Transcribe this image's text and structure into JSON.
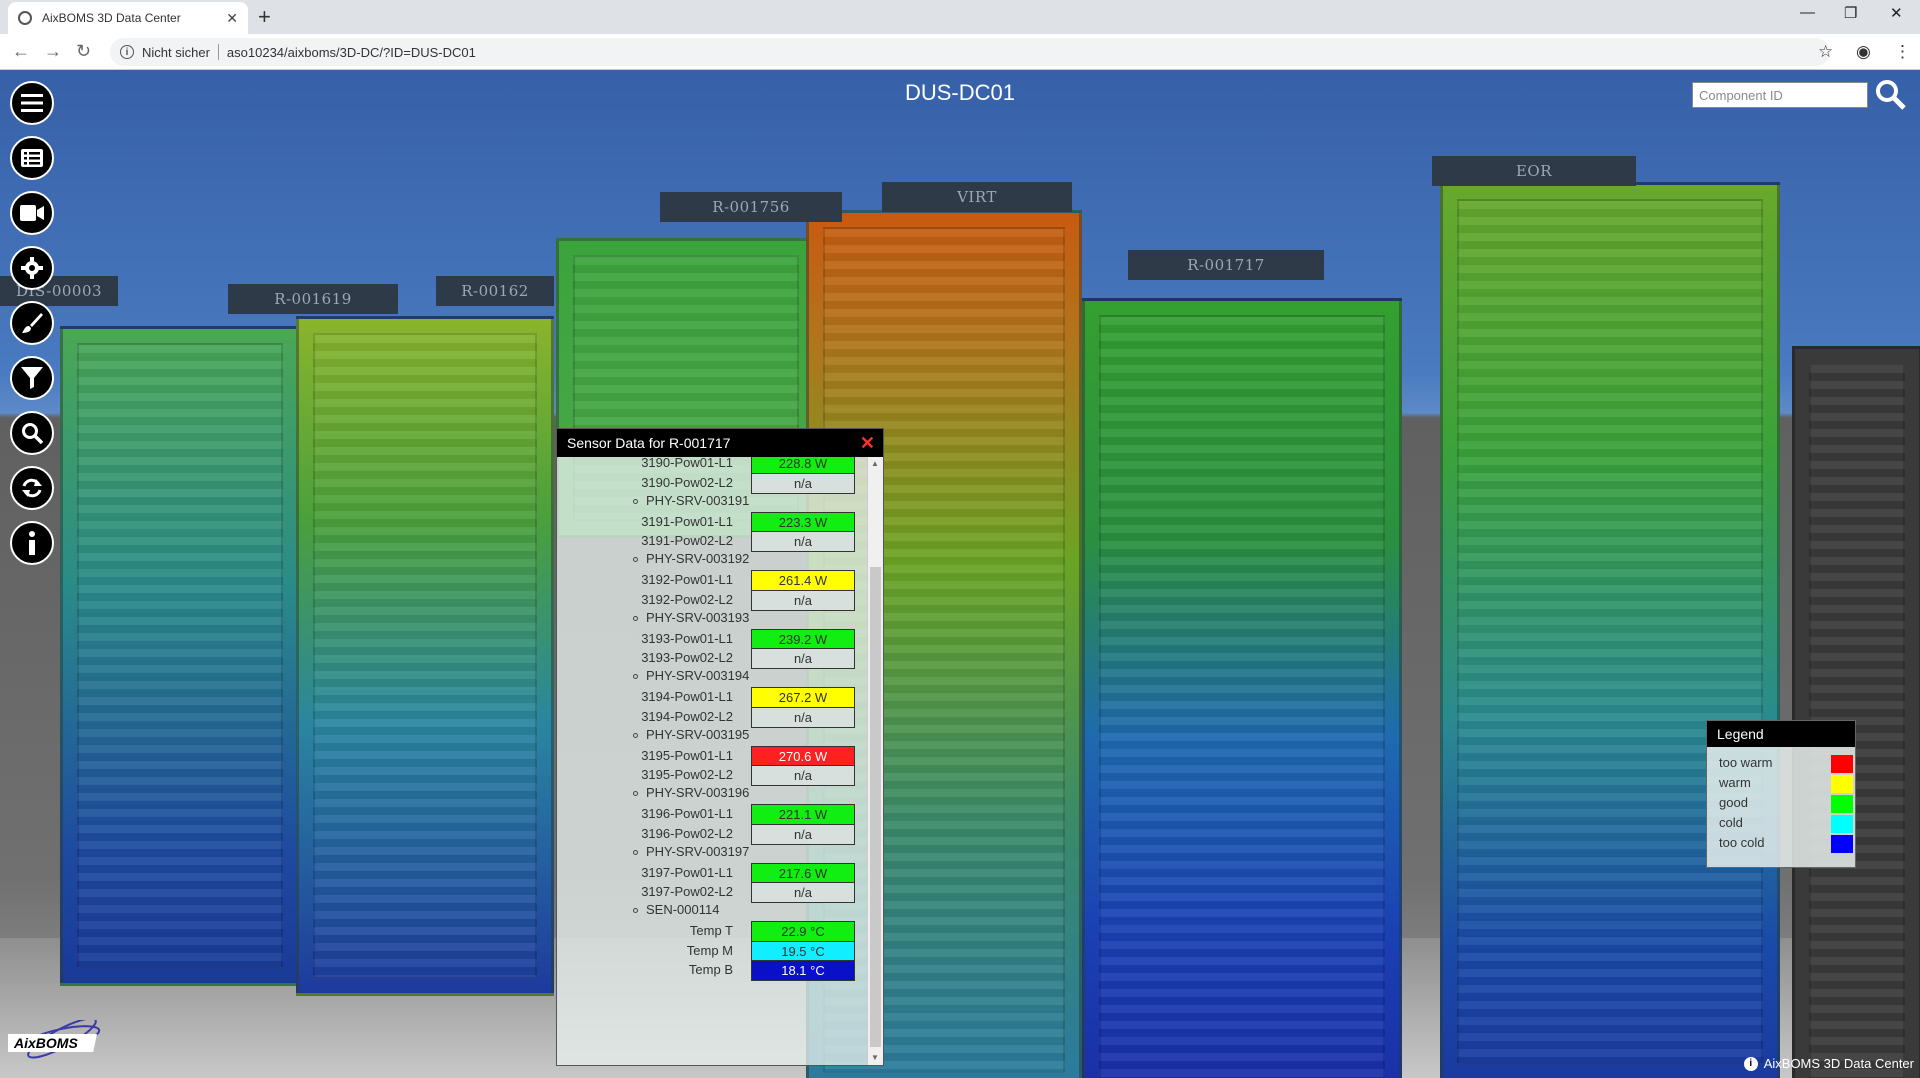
{
  "browser": {
    "tab_title": "AixBOMS 3D Data Center",
    "security_label": "Nicht sicher",
    "url": "aso10234/aixboms/3D-DC/?ID=DUS-DC01"
  },
  "app": {
    "title": "DUS-DC01",
    "search_placeholder": "Component ID",
    "footer": "AixBOMS 3D Data Center",
    "logo_text": "AixBOMS"
  },
  "left_nav": [
    "menu-icon",
    "list-icon",
    "camera-icon",
    "gear-icon",
    "brush-icon",
    "filter-icon",
    "search-icon",
    "refresh-icon",
    "info-icon"
  ],
  "racks": [
    "DIS-00003",
    "R-001619",
    "R-00162",
    "R-001756",
    "VIRT",
    "R-001717",
    "EOR"
  ],
  "sensor_panel": {
    "title": "Sensor Data for R-001717",
    "rows": [
      {
        "kind": "value",
        "label": "3190-Pow01-L1",
        "value": "228.8 W",
        "status": "good"
      },
      {
        "kind": "value",
        "label": "3190-Pow02-L2",
        "value": "n/a",
        "status": "na"
      },
      {
        "kind": "group",
        "label": "PHY-SRV-003191"
      },
      {
        "kind": "value",
        "label": "3191-Pow01-L1",
        "value": "223.3 W",
        "status": "good"
      },
      {
        "kind": "value",
        "label": "3191-Pow02-L2",
        "value": "n/a",
        "status": "na"
      },
      {
        "kind": "group",
        "label": "PHY-SRV-003192"
      },
      {
        "kind": "value",
        "label": "3192-Pow01-L1",
        "value": "261.4 W",
        "status": "warm"
      },
      {
        "kind": "value",
        "label": "3192-Pow02-L2",
        "value": "n/a",
        "status": "na"
      },
      {
        "kind": "group",
        "label": "PHY-SRV-003193"
      },
      {
        "kind": "value",
        "label": "3193-Pow01-L1",
        "value": "239.2 W",
        "status": "good"
      },
      {
        "kind": "value",
        "label": "3193-Pow02-L2",
        "value": "n/a",
        "status": "na"
      },
      {
        "kind": "group",
        "label": "PHY-SRV-003194"
      },
      {
        "kind": "value",
        "label": "3194-Pow01-L1",
        "value": "267.2 W",
        "status": "warm"
      },
      {
        "kind": "value",
        "label": "3194-Pow02-L2",
        "value": "n/a",
        "status": "na"
      },
      {
        "kind": "group",
        "label": "PHY-SRV-003195"
      },
      {
        "kind": "value",
        "label": "3195-Pow01-L1",
        "value": "270.6 W",
        "status": "too-warm"
      },
      {
        "kind": "value",
        "label": "3195-Pow02-L2",
        "value": "n/a",
        "status": "na"
      },
      {
        "kind": "group",
        "label": "PHY-SRV-003196"
      },
      {
        "kind": "value",
        "label": "3196-Pow01-L1",
        "value": "221.1 W",
        "status": "good"
      },
      {
        "kind": "value",
        "label": "3196-Pow02-L2",
        "value": "n/a",
        "status": "na"
      },
      {
        "kind": "group",
        "label": "PHY-SRV-003197"
      },
      {
        "kind": "value",
        "label": "3197-Pow01-L1",
        "value": "217.6 W",
        "status": "good"
      },
      {
        "kind": "value",
        "label": "3197-Pow02-L2",
        "value": "n/a",
        "status": "na"
      },
      {
        "kind": "group",
        "label": "SEN-000114"
      },
      {
        "kind": "value",
        "label": "Temp T",
        "value": "22.9 °C",
        "status": "good"
      },
      {
        "kind": "value",
        "label": "Temp M",
        "value": "19.5 °C",
        "status": "cold"
      },
      {
        "kind": "value",
        "label": "Temp B",
        "value": "18.1 °C",
        "status": "too-cold"
      }
    ]
  },
  "legend": {
    "title": "Legend",
    "items": [
      {
        "label": "too warm",
        "color": "#ff0000"
      },
      {
        "label": "warm",
        "color": "#ffff00"
      },
      {
        "label": "good",
        "color": "#00ff00"
      },
      {
        "label": "cold",
        "color": "#00ffff"
      },
      {
        "label": "too cold",
        "color": "#0000ff"
      }
    ]
  },
  "status_colors": {
    "too-warm": "#ff2020",
    "warm": "#ffff00",
    "good": "#11ee11",
    "cold": "#11eeff",
    "too-cold": "#0a10c8",
    "na": "#d7e0dc"
  }
}
